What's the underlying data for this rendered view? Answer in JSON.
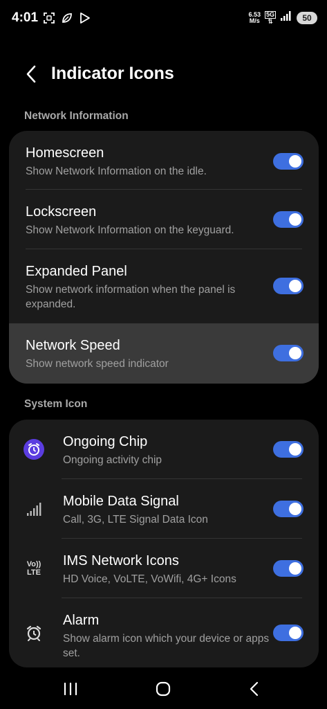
{
  "status_bar": {
    "time": "4:01",
    "left_icons": [
      "screenshot-icon",
      "leaf-icon",
      "play-store-icon"
    ],
    "net_speed_value": "6.53",
    "net_speed_unit": "M/s",
    "network_type": "5G",
    "battery": "50"
  },
  "header": {
    "title": "Indicator Icons"
  },
  "sections": [
    {
      "label": "Network Information",
      "items": [
        {
          "title": "Homescreen",
          "subtitle": "Show Network Information on the idle.",
          "enabled": true
        },
        {
          "title": "Lockscreen",
          "subtitle": "Show Network Information on the keyguard.",
          "enabled": true
        },
        {
          "title": "Expanded Panel",
          "subtitle": "Show network information when the panel is expanded.",
          "enabled": true
        },
        {
          "title": "Network Speed",
          "subtitle": "Show network speed indicator",
          "enabled": true
        }
      ]
    },
    {
      "label": "System Icon",
      "items": [
        {
          "title": "Ongoing Chip",
          "subtitle": "Ongoing activity chip",
          "icon": "alarm-clock-icon",
          "enabled": true
        },
        {
          "title": "Mobile Data Signal",
          "subtitle": "Call, 3G, LTE Signal Data Icon",
          "icon": "signal-bars-icon",
          "enabled": true
        },
        {
          "title": "IMS Network Icons",
          "subtitle": "HD Voice, VoLTE, VoWifi, 4G+ Icons",
          "icon": "volte-icon",
          "icon_text_top": "Vo))",
          "icon_text_bottom": "LTE",
          "enabled": true
        },
        {
          "title": "Alarm",
          "subtitle": "Show alarm icon which your device or apps set.",
          "icon": "alarm-icon",
          "enabled": true
        }
      ]
    }
  ],
  "colors": {
    "accent": "#3e6fe0",
    "card": "#1b1b1b",
    "highlight": "#3a3a3a",
    "chip_icon": "#5b3de0"
  },
  "nav": [
    "recents-icon",
    "home-icon",
    "back-icon"
  ]
}
